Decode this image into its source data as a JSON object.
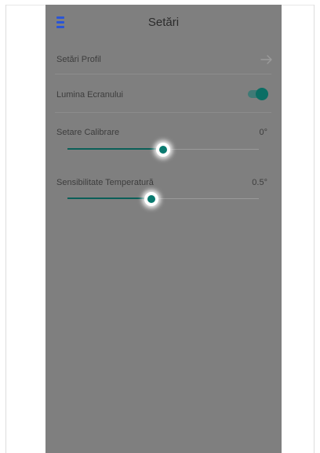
{
  "header": {
    "title": "Setări"
  },
  "settings": {
    "profile_label": "Setări Profil",
    "screen_light_label": "Lumina Ecranului",
    "screen_light_on": true,
    "calibration_label": "Setare Calibrare",
    "calibration_value": "0°",
    "calibration_level": 0.5,
    "sensitivity_label": "Sensibilitate Temperatură",
    "sensitivity_value": "0.5°",
    "sensitivity_level": 0.44
  },
  "colors": {
    "accent": "#0b7a70",
    "menu_icon": "#2a55d6",
    "overlay_bg": "#7f7f7f"
  },
  "icons": {
    "menu": "menu-icon",
    "arrow": "arrow-right-icon"
  }
}
